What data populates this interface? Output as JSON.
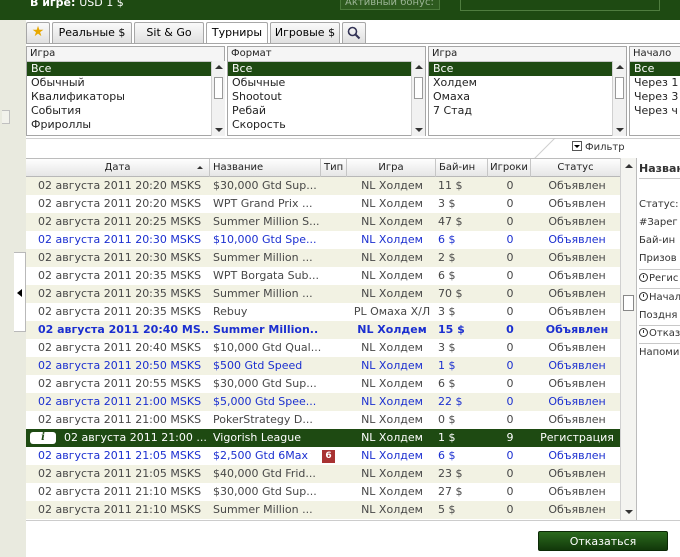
{
  "topbar": {
    "in_game_label": "В игре:",
    "in_game_value": "USD 1 $",
    "active_bonus_label": "Активный бонус:"
  },
  "tabs": [
    {
      "label": "Реальные $"
    },
    {
      "label": "Sit & Go"
    },
    {
      "label": "Турниры"
    },
    {
      "label": "Игровые $"
    }
  ],
  "filters": {
    "game": {
      "header": "Игра",
      "items": [
        "Все",
        "Обычный",
        "Квалификаторы",
        "События",
        "Фрироллы"
      ]
    },
    "format": {
      "header": "Формат",
      "items": [
        "Все",
        "Обычные",
        "Shootout",
        "Ребай",
        "Скорость"
      ]
    },
    "game2": {
      "header": "Игра",
      "items": [
        "Все",
        "Холдем",
        "Омаха",
        "7 Стад"
      ]
    },
    "start": {
      "header": "Начало",
      "items": [
        "Все",
        "Через 1",
        "Через 3",
        "Через ч"
      ]
    },
    "filter_button": "Фильтр"
  },
  "columns": {
    "date": "Дата",
    "name": "Название",
    "type": "Тип",
    "game": "Игра",
    "buyin": "Бай-ин",
    "players": "Игроки",
    "status": "Статус"
  },
  "rows": [
    {
      "date": "02 августа 2011 20:20 MSKS",
      "name": "$30,000 Gtd Sup...",
      "type": "",
      "game": "NL Холдем",
      "buyin": "11 $",
      "players": "0",
      "status": "Объявлен"
    },
    {
      "date": "02 августа 2011 20:20 MSKS",
      "name": "WPT Grand Prix ...",
      "type": "",
      "game": "NL Холдем",
      "buyin": "3 $",
      "players": "0",
      "status": "Объявлен"
    },
    {
      "date": "02 августа 2011 20:25 MSKS",
      "name": "Summer Million S...",
      "type": "",
      "game": "NL Холдем",
      "buyin": "47 $",
      "players": "0",
      "status": "Объявлен"
    },
    {
      "date": "02 августа 2011 20:30 MSKS",
      "name": "$10,000 Gtd Spe...",
      "type": "",
      "game": "NL Холдем",
      "buyin": "6 $",
      "players": "0",
      "status": "Объявлен"
    },
    {
      "date": "02 августа 2011 20:30 MSKS",
      "name": "Summer Million ...",
      "type": "",
      "game": "NL Холдем",
      "buyin": "2 $",
      "players": "0",
      "status": "Объявлен"
    },
    {
      "date": "02 августа 2011 20:35 MSKS",
      "name": "WPT Borgata Sub...",
      "type": "",
      "game": "NL Холдем",
      "buyin": "6 $",
      "players": "0",
      "status": "Объявлен"
    },
    {
      "date": "02 августа 2011 20:35 MSKS",
      "name": "Summer Million ...",
      "type": "",
      "game": "NL Холдем",
      "buyin": "70 $",
      "players": "0",
      "status": "Объявлен"
    },
    {
      "date": "02 августа 2011 20:35 MSKS",
      "name": "Rebuy",
      "type": "",
      "game": "PL Омаха Х/Л",
      "buyin": "3 $",
      "players": "0",
      "status": "Объявлен"
    },
    {
      "date": "02 августа 2011 20:40 MS..",
      "name": "Summer Million..",
      "type": "",
      "game": "NL Холдем",
      "buyin": "15 $",
      "players": "0",
      "status": "Объявлен"
    },
    {
      "date": "02 августа 2011 20:40 MSKS",
      "name": "$10,000 Gtd Qual...",
      "type": "",
      "game": "NL Холдем",
      "buyin": "3 $",
      "players": "0",
      "status": "Объявлен"
    },
    {
      "date": "02 августа 2011 20:50 MSKS",
      "name": "$500 Gtd Speed",
      "type": "",
      "game": "NL Холдем",
      "buyin": "1 $",
      "players": "0",
      "status": "Объявлен"
    },
    {
      "date": "02 августа 2011 20:55 MSKS",
      "name": "$30,000 Gtd Sup...",
      "type": "",
      "game": "NL Холдем",
      "buyin": "6 $",
      "players": "0",
      "status": "Объявлен"
    },
    {
      "date": "02 августа 2011 21:00 MSKS",
      "name": "$5,000 Gtd Spee...",
      "type": "",
      "game": "NL Холдем",
      "buyin": "22 $",
      "players": "0",
      "status": "Объявлен"
    },
    {
      "date": "02 августа 2011 21:00 MSKS",
      "name": "PokerStrategy D...",
      "type": "",
      "game": "NL Холдем",
      "buyin": "0 $",
      "players": "0",
      "status": "Объявлен"
    },
    {
      "date": "02 августа 2011 21:00 ...",
      "name": "Vigorish League",
      "type": "",
      "game": "NL Холдем",
      "buyin": "1 $",
      "players": "9",
      "status": "Регистрация"
    },
    {
      "date": "02 августа 2011 21:05 MSKS",
      "name": "$2,500 Gtd 6Max",
      "type": "6",
      "game": "NL Холдем",
      "buyin": "6 $",
      "players": "0",
      "status": "Объявлен"
    },
    {
      "date": "02 августа 2011 21:05 MSKS",
      "name": "$40,000 Gtd Frid...",
      "type": "",
      "game": "NL Холдем",
      "buyin": "23 $",
      "players": "0",
      "status": "Объявлен"
    },
    {
      "date": "02 августа 2011 21:10 MSKS",
      "name": "$30,000 Gtd Sup...",
      "type": "",
      "game": "NL Холдем",
      "buyin": "27 $",
      "players": "0",
      "status": "Объявлен"
    },
    {
      "date": "02 августа 2011 21:10 MSKS",
      "name": "Summer Million ...",
      "type": "",
      "game": "NL Холдем",
      "buyin": "5 $",
      "players": "0",
      "status": "Объявлен"
    }
  ],
  "info_icon_label": "i",
  "right_panel": {
    "title": "Назван",
    "status": "Статус:",
    "registered": "#Зарег",
    "buyin": "Бай-ин",
    "prize": "Призов",
    "register_btn": "Регис",
    "start_btn": "Начал",
    "late": "Поздня",
    "cancel_btn": "Отказ",
    "remind": "Напоми"
  },
  "bottom": {
    "refuse_button": "Отказаться"
  },
  "colors": {
    "brand_green": "#1e4a12",
    "row_stripe": "#f2f2e3",
    "highlight_blue": "#1b2fd0",
    "badge_red": "#a83232"
  }
}
